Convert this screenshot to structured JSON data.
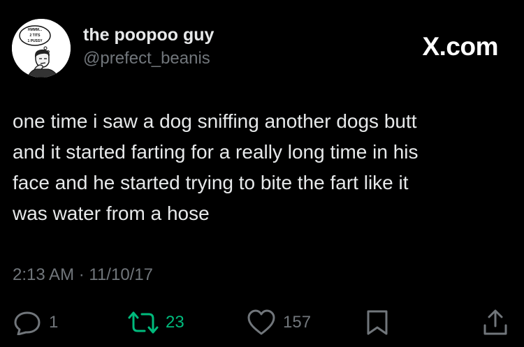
{
  "author": {
    "display_name": "the poopoo guy",
    "handle": "@prefect_beanis",
    "avatar_icon": "cartoon-man-thinking-icon",
    "avatar_bubble_lines": [
      "HMMM...",
      "2 TITS",
      "1 PUSSY"
    ]
  },
  "brand": {
    "label": "X.com"
  },
  "tweet": {
    "lines": [
      "one time i saw a dog sniffing another dogs butt",
      "and it started farting for a really long time in his",
      "face and he started trying to bite the fart like it",
      "was water from a hose"
    ],
    "timestamp": "2:13 AM · 11/10/17"
  },
  "actions": {
    "reply": {
      "icon": "reply-icon",
      "count": "1"
    },
    "retweet": {
      "icon": "retweet-icon",
      "count": "23",
      "color": "#00ba7c"
    },
    "like": {
      "icon": "heart-icon",
      "count": "157"
    },
    "bookmark": {
      "icon": "bookmark-icon"
    },
    "share": {
      "icon": "share-icon"
    }
  },
  "colors": {
    "background": "#000000",
    "primary_text": "#e7e9ea",
    "secondary_text": "#71767b",
    "retweet_active": "#00ba7c"
  }
}
